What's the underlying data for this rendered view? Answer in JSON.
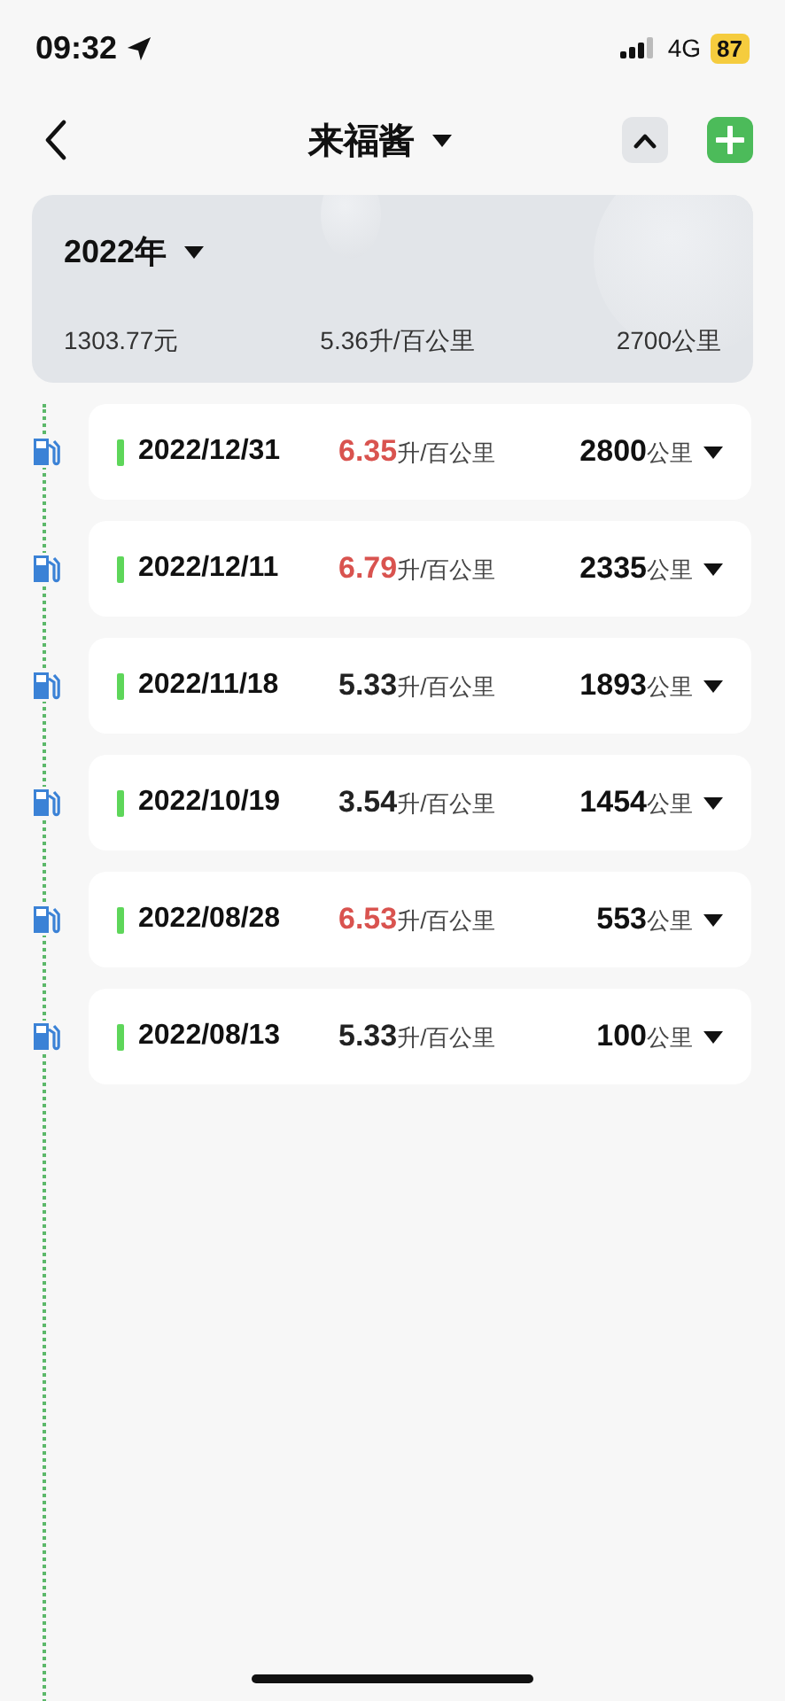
{
  "status_bar": {
    "time": "09:32",
    "network": "4G",
    "battery": "87"
  },
  "nav": {
    "title": "来福酱"
  },
  "summary": {
    "year": "2022年",
    "cost": "1303.77元",
    "consumption": "5.36升/百公里",
    "distance": "2700公里"
  },
  "records": [
    {
      "date": "2022/12/31",
      "consumption": "6.35",
      "consumption_unit": "升/百公里",
      "odometer": "2800",
      "odometer_unit": "公里",
      "high": true
    },
    {
      "date": "2022/12/11",
      "consumption": "6.79",
      "consumption_unit": "升/百公里",
      "odometer": "2335",
      "odometer_unit": "公里",
      "high": true
    },
    {
      "date": "2022/11/18",
      "consumption": "5.33",
      "consumption_unit": "升/百公里",
      "odometer": "1893",
      "odometer_unit": "公里",
      "high": false
    },
    {
      "date": "2022/10/19",
      "consumption": "3.54",
      "consumption_unit": "升/百公里",
      "odometer": "1454",
      "odometer_unit": "公里",
      "high": false
    },
    {
      "date": "2022/08/28",
      "consumption": "6.53",
      "consumption_unit": "升/百公里",
      "odometer": "553",
      "odometer_unit": "公里",
      "high": true
    },
    {
      "date": "2022/08/13",
      "consumption": "5.33",
      "consumption_unit": "升/百公里",
      "odometer": "100",
      "odometer_unit": "公里",
      "high": false
    }
  ]
}
